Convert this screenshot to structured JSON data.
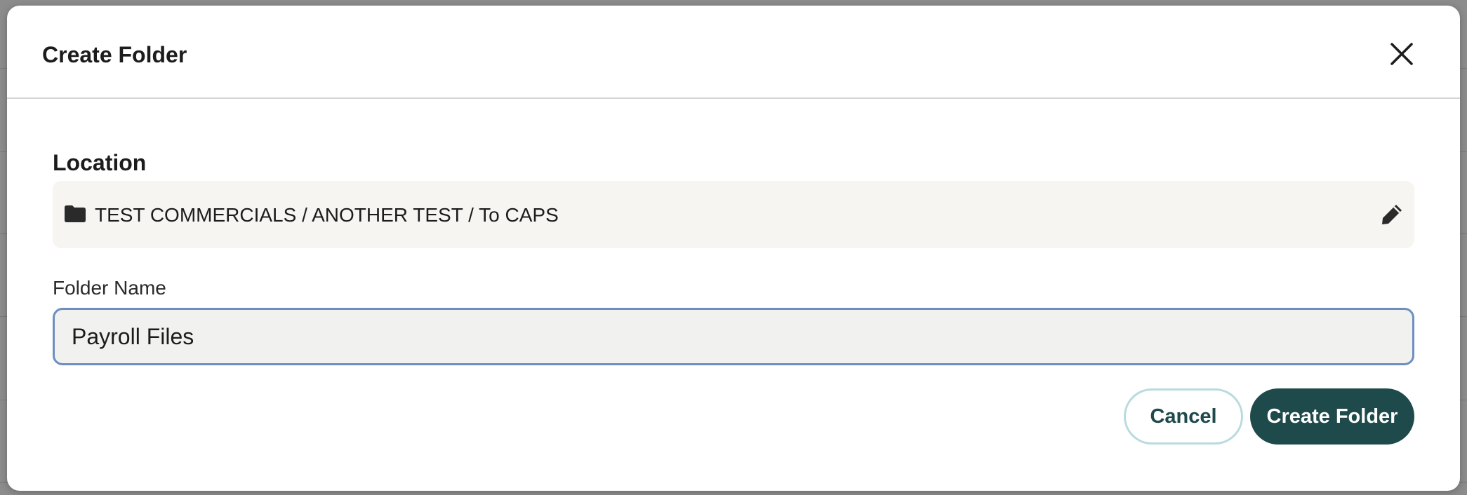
{
  "dialog": {
    "title": "Create Folder",
    "close_icon": "close-icon"
  },
  "location": {
    "label": "Location",
    "folder_icon": "folder-icon",
    "path": "TEST COMMERCIALS / ANOTHER TEST / To CAPS",
    "edit_icon": "pencil-icon"
  },
  "folder_name": {
    "label": "Folder Name",
    "value": "Payroll Files"
  },
  "actions": {
    "cancel_label": "Cancel",
    "create_label": "Create Folder"
  },
  "colors": {
    "primary_button": "#1f4a4b",
    "cancel_border": "#b8dbde",
    "input_focus_border": "#6d8fbf",
    "location_bg": "#f7f5f1"
  }
}
